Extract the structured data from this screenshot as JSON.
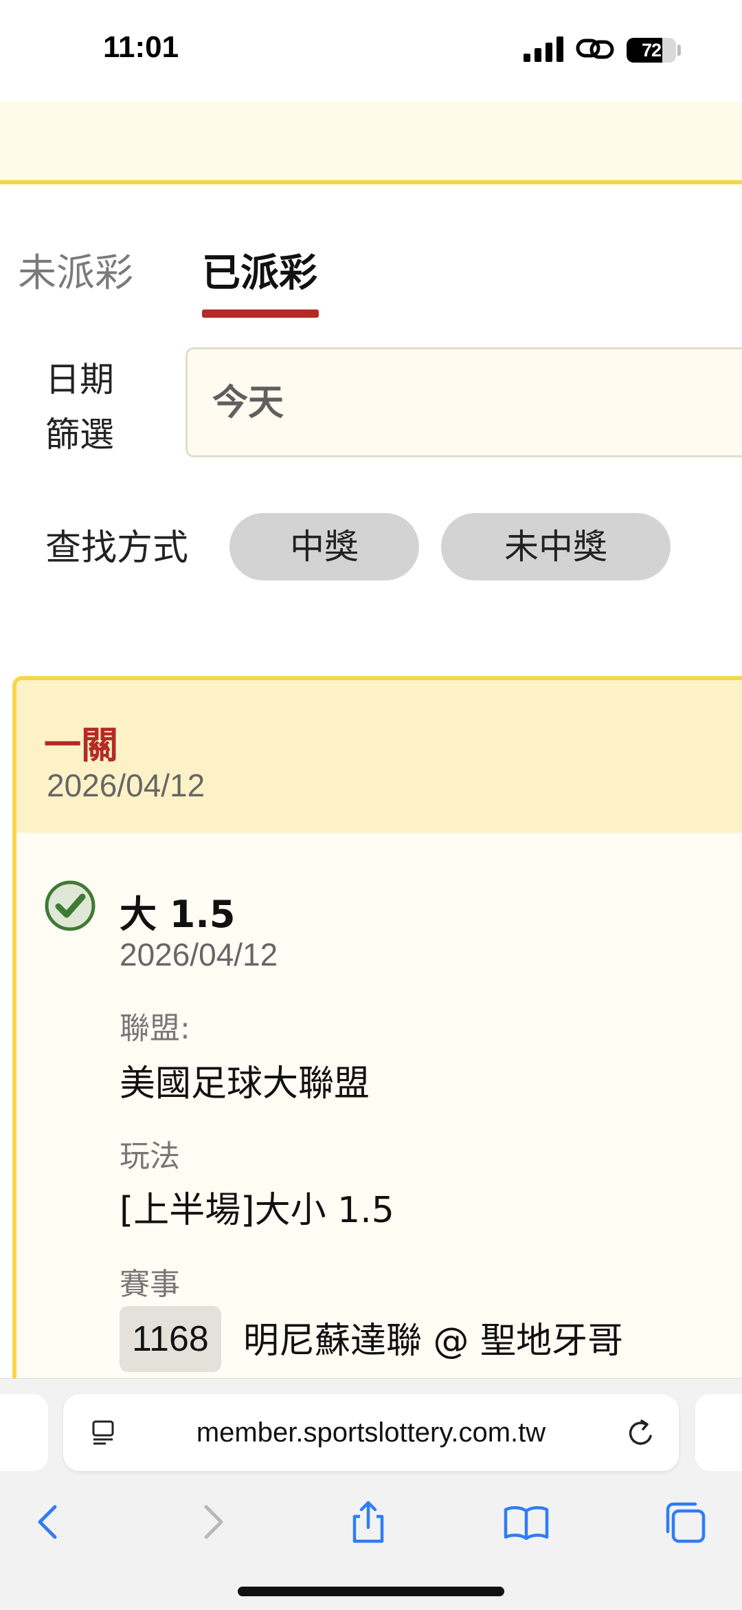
{
  "status_bar": {
    "time": "11:01",
    "battery": "72",
    "battery_level": 0.72
  },
  "tabs": {
    "pending": "未派彩",
    "paid": "已派彩"
  },
  "date_filter": {
    "label": "日期篩選",
    "value": "今天"
  },
  "search": {
    "label": "查找方式",
    "win": "中獎",
    "lose": "未中獎"
  },
  "bet": {
    "type": "一關",
    "date": "2026/04/12",
    "selection": {
      "title": "大 1.5",
      "date": "2026/04/12",
      "league_label": "聯盟:",
      "league": "美國足球大聯盟",
      "play_label": "玩法",
      "play": "[上半場]大小 1.5",
      "event_label": "賽事",
      "event_code": "1168",
      "event_name": "明尼蘇達聯 @ 聖地牙哥"
    }
  },
  "browser": {
    "url": "member.sportslottery.com.tw"
  },
  "colors": {
    "accent_red": "#b22b24",
    "accent_yellow": "#f7d54a",
    "win_green": "#3f7a34"
  }
}
